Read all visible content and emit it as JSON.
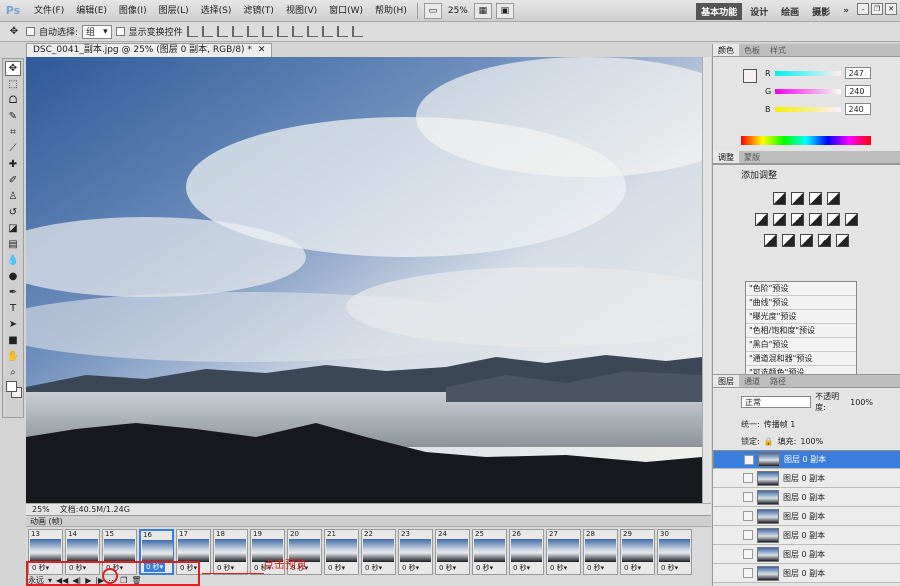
{
  "app": {
    "logo": "Ps",
    "menus": [
      "文件(F)",
      "编辑(E)",
      "图像(I)",
      "图层(L)",
      "选择(S)",
      "滤镜(T)",
      "视图(V)",
      "窗口(W)",
      "帮助(H)"
    ],
    "zoom": "25%",
    "workspaces": [
      "基本功能",
      "设计",
      "绘画",
      "摄影"
    ],
    "workspace_more": "»"
  },
  "options": {
    "auto_select_label": "自动选择:",
    "auto_select_value": "组",
    "show_transform_label": "显示变换控件"
  },
  "document": {
    "tab_title": "DSC_0041_副本.jpg @ 25% (图层 0 副本, RGB/8) *",
    "zoom": "25%",
    "doc_size": "文档:40.5M/1.24G"
  },
  "animation": {
    "title": "动画 (帧)",
    "frames": [
      {
        "num": "13",
        "delay": "0 秒▾"
      },
      {
        "num": "14",
        "delay": "0 秒▾"
      },
      {
        "num": "15",
        "delay": "0 秒▾"
      },
      {
        "num": "16",
        "delay": "0 秒▾"
      },
      {
        "num": "17",
        "delay": "0 秒▾"
      },
      {
        "num": "18",
        "delay": "0 秒▾"
      },
      {
        "num": "19",
        "delay": "0 秒▾"
      },
      {
        "num": "20",
        "delay": "0 秒▾"
      },
      {
        "num": "21",
        "delay": "0 秒▾"
      },
      {
        "num": "22",
        "delay": "0 秒▾"
      },
      {
        "num": "23",
        "delay": "0 秒▾"
      },
      {
        "num": "24",
        "delay": "0 秒▾"
      },
      {
        "num": "25",
        "delay": "0 秒▾"
      },
      {
        "num": "26",
        "delay": "0 秒▾"
      },
      {
        "num": "27",
        "delay": "0 秒▾"
      },
      {
        "num": "28",
        "delay": "0 秒▾"
      },
      {
        "num": "29",
        "delay": "0 秒▾"
      },
      {
        "num": "30",
        "delay": "0 秒▾"
      }
    ],
    "selected_frame": "16",
    "loop": "永远",
    "annotation": "点击预览"
  },
  "color_panel": {
    "tabs": [
      "颜色",
      "色板",
      "样式"
    ],
    "r_label": "R",
    "r": "247",
    "g_label": "G",
    "g": "240",
    "b_label": "B",
    "b": "240"
  },
  "adjust_panel": {
    "tabs": [
      "调整",
      "蒙版"
    ],
    "title": "添加调整",
    "presets": [
      "\"色阶\"预设",
      "\"曲线\"预设",
      "\"曝光度\"预设",
      "\"色相/饱和度\"预设",
      "\"黑白\"预设",
      "\"通道混和器\"预设",
      "\"可选颜色\"预设"
    ]
  },
  "layers_panel": {
    "tabs": [
      "图层",
      "通道",
      "路径"
    ],
    "blend_mode": "正常",
    "opacity_label": "不透明度:",
    "opacity": "100%",
    "unify_label": "统一:",
    "propagate_label": "传播帧 1",
    "lock_label": "锁定:",
    "fill_label": "填充:",
    "fill": "100%",
    "layers": [
      "图层 0 副本",
      "图层 0 副本",
      "图层 0 副本",
      "图层 0 副本",
      "图层 0 副本",
      "图层 0 副本",
      "图层 0 副本"
    ]
  }
}
